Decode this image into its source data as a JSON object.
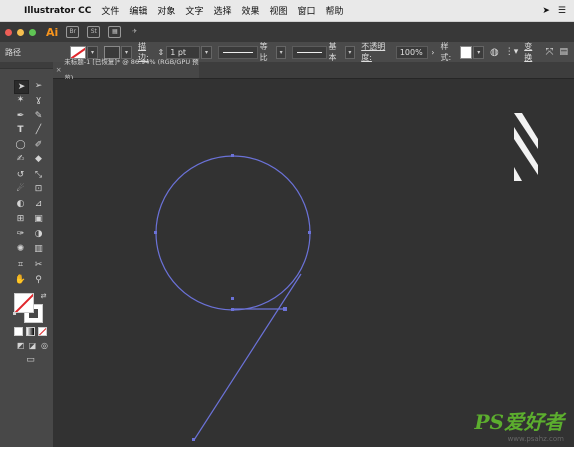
{
  "menubar": {
    "apple": "",
    "app_name": "Illustrator CC",
    "menus": [
      "文件",
      "编辑",
      "对象",
      "文字",
      "选择",
      "效果",
      "视图",
      "窗口",
      "帮助"
    ]
  },
  "appbar": {
    "logo": "Ai",
    "light_colors": [
      "#ee5e56",
      "#f5be4f",
      "#5fc454"
    ],
    "brand_color": "#f7941d"
  },
  "control_bar": {
    "selection_label": "路径",
    "stroke_label": "描边:",
    "stroke_weight": "1 pt",
    "profile_label": "等比",
    "brush_label": "基本",
    "opacity_label": "不透明度:",
    "opacity_value": "100%",
    "style_label": "样式:",
    "transform_label": "变换"
  },
  "document_tab": {
    "title": "未标题-1 [已恢复]* @ 86.94% (RGB/GPU 预览)",
    "close_glyph": "×"
  },
  "tools": [
    "selection-tool",
    "direct-selection-tool",
    "magic-wand-tool",
    "lasso-tool",
    "pen-tool",
    "curvature-tool",
    "type-tool",
    "line-segment-tool",
    "ellipse-tool",
    "paintbrush-tool",
    "shaper-tool",
    "eraser-tool",
    "rotate-tool",
    "scale-tool",
    "warp-tool",
    "free-transform-tool",
    "shape-builder-tool",
    "perspective-grid-tool",
    "mesh-tool",
    "gradient-tool",
    "eyedropper-tool",
    "blend-tool",
    "symbol-sprayer-tool",
    "column-graph-tool",
    "artboard-tool",
    "slice-tool",
    "hand-tool",
    "zoom-tool"
  ],
  "colors": {
    "canvas_bg": "#323232",
    "path_stroke": "#6b72d8",
    "none_slash": "#e0262b"
  },
  "watermark": {
    "big": "PS爱好者",
    "small": "www.psahz.com"
  }
}
